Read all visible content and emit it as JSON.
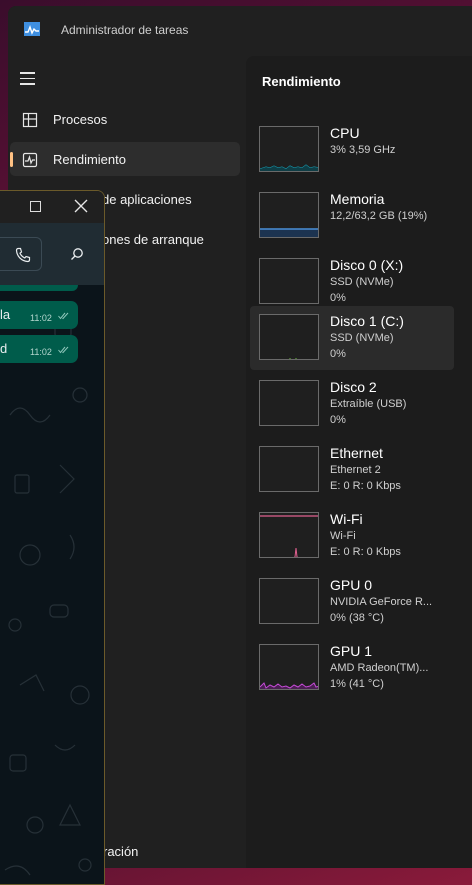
{
  "window": {
    "title": "Administrador de tareas"
  },
  "nav": {
    "items": [
      {
        "label": "Procesos",
        "icon": "processes-icon"
      },
      {
        "label": "Rendimiento",
        "icon": "performance-icon",
        "active": true
      },
      {
        "label": "de aplicaciones",
        "icon": "app-history-icon"
      },
      {
        "label": "ones de arranque",
        "icon": "startup-apps-icon"
      }
    ],
    "bottom_label": "ración"
  },
  "performance": {
    "header": "Rendimiento",
    "items": [
      {
        "name": "CPU",
        "line1": "3% 3,59 GHz",
        "line2": "",
        "color": "#17a2b8"
      },
      {
        "name": "Memoria",
        "line1": "12,2/63,2 GB (19%)",
        "line2": "",
        "color": "#4a90d9"
      },
      {
        "name": "Disco 0 (X:)",
        "line1": "SSD (NVMe)",
        "line2": "0%",
        "color": "#6abf3a"
      },
      {
        "name": "Disco 1 (C:)",
        "line1": "SSD (NVMe)",
        "line2": "0%",
        "color": "#6abf3a"
      },
      {
        "name": "Disco 2",
        "line1": "Extraíble (USB)",
        "line2": "0%",
        "color": "#6abf3a"
      },
      {
        "name": "Ethernet",
        "line1": "Ethernet 2",
        "line2": "E: 0 R: 0 Kbps",
        "color": "#c25a8a"
      },
      {
        "name": "Wi-Fi",
        "line1": "Wi-Fi",
        "line2": "E: 0 R: 0 Kbps",
        "color": "#e0608f"
      },
      {
        "name": "GPU 0",
        "line1": "NVIDIA GeForce R...",
        "line2": "0% (38 °C)",
        "color": "#b44cc9"
      },
      {
        "name": "GPU 1",
        "line1": "AMD Radeon(TM)...",
        "line2": "1% (41 °C)",
        "color": "#c54bd6"
      }
    ]
  },
  "whatsapp": {
    "messages": [
      {
        "text": "la",
        "time": "11:02"
      },
      {
        "text": "d",
        "time": "11:02"
      }
    ]
  }
}
